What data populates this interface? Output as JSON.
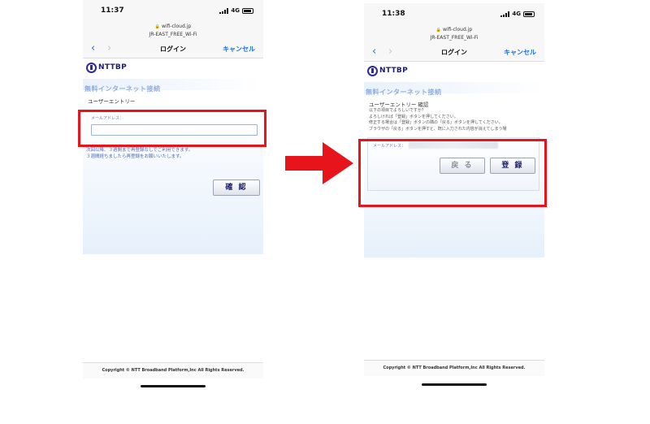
{
  "screens": [
    {
      "status": {
        "time": "11:37",
        "network": "4G"
      },
      "url": {
        "domain": "wifi-cloud.jp",
        "ssid": "JR-EAST_FREE_Wi-Fi"
      },
      "nav": {
        "back": "‹",
        "forward": "›",
        "title": "ログイン",
        "cancel": "キャンセル"
      },
      "logo": "NTTBP",
      "page_title": "無料インターネット接続",
      "section_title": "ユーザーエントリー",
      "email_label": "メールアドレス：",
      "note": [
        "次回以降、３週間まで再登録なしでご利用できます。",
        "３週間経ちましたら再登録をお願いいたします。"
      ],
      "confirm_button": "確 認",
      "footer": "Copyright © NTT Broadband Platform,Inc All Rights Reserved."
    },
    {
      "status": {
        "time": "11:38",
        "network": "4G"
      },
      "url": {
        "domain": "wifi-cloud.jp",
        "ssid": "JR-EAST_FREE_Wi-Fi"
      },
      "nav": {
        "back": "‹",
        "forward": "›",
        "title": "ログイン",
        "cancel": "キャンセル"
      },
      "logo": "NTTBP",
      "page_title": "無料インターネット接続",
      "section_title": "ユーザーエントリー 確認",
      "description": [
        "以下の項目でよろしいですか？",
        "よろしければ「登録」ボタンを押してください。",
        "修正する場合は「登録」ボタンの隣の「戻る」ボタンを押してください。",
        "ブラウザの「戻る」ボタンを押すと、既に入力された内容が消えてしまう場"
      ],
      "email_label": "メールアドレス：",
      "back_button": "戻 る",
      "register_button": "登 録",
      "footer": "Copyright © NTT Broadband Platform,Inc All Rights Reserved."
    }
  ],
  "colors": {
    "highlight": "#e8141c",
    "arrow": "#e8141c",
    "link": "#1a73e8"
  }
}
